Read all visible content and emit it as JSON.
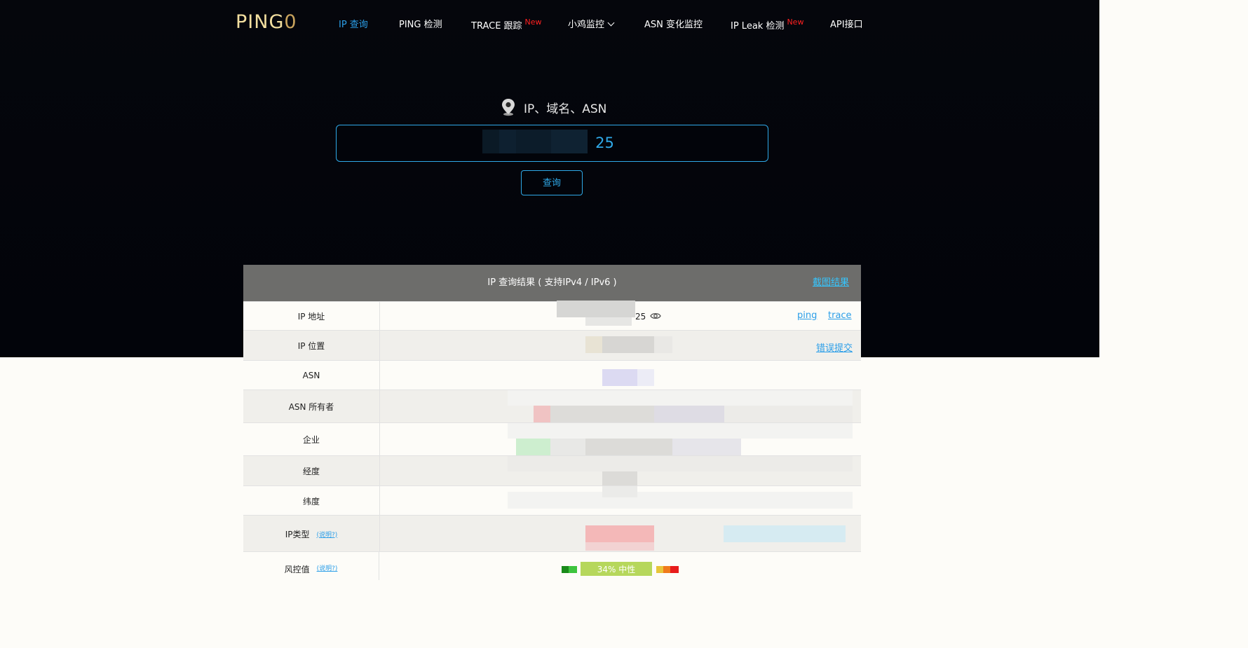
{
  "brand": {
    "logo_main": "PING",
    "logo_zero": "0"
  },
  "nav": {
    "items": [
      {
        "label": "IP 查询",
        "active": true
      },
      {
        "label": "PING 检测"
      },
      {
        "label": "TRACE 跟踪",
        "badge": "New"
      },
      {
        "label": "小鸡监控",
        "dropdown": true
      },
      {
        "label": "ASN 变化监控"
      },
      {
        "label": "IP Leak 检测",
        "badge": "New"
      },
      {
        "label": "API接口"
      }
    ]
  },
  "search": {
    "label": "IP、域名、ASN",
    "value_visible": "25",
    "button": "查询"
  },
  "result": {
    "title": "IP 查询结果 ( 支持IPv4 / IPv6 )",
    "screenshot_link": "截图结果",
    "rows": [
      {
        "label": "IP 地址",
        "value_visible": "25",
        "links": [
          "ping",
          "trace"
        ]
      },
      {
        "label": "IP 位置",
        "links": [
          "错误提交"
        ]
      },
      {
        "label": "ASN"
      },
      {
        "label": "ASN 所有者"
      },
      {
        "label": "企业"
      },
      {
        "label": "经度"
      },
      {
        "label": "纬度"
      },
      {
        "label": "IP类型",
        "hint": "(说明?)"
      },
      {
        "label": "风控值",
        "hint": "(说明?)",
        "risk": "34%  中性"
      }
    ]
  },
  "colors": {
    "accent": "#2fa9e8",
    "new_badge": "#ff2020",
    "logo": "#f3dfa0",
    "panel_header": "#6d6d6b"
  }
}
